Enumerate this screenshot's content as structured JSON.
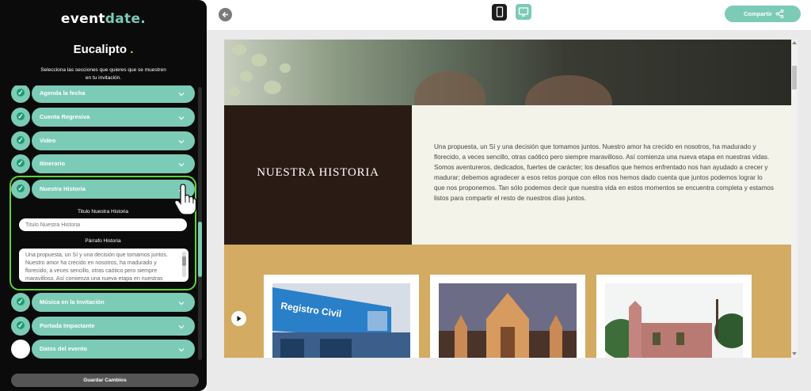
{
  "brand": {
    "logo_main": "event",
    "logo_accent": "date",
    "logo_suffix": "."
  },
  "theme": {
    "name": "Eucalipto",
    "dot": "."
  },
  "instructions": "Selecciona las secciones que quieres que se muestren en tu invitación.",
  "sections": [
    {
      "label": "Agenda la fecha",
      "enabled": true
    },
    {
      "label": "Cuenta Regresiva",
      "enabled": true
    },
    {
      "label": "Video",
      "enabled": true
    },
    {
      "label": "Itinerario",
      "enabled": true
    },
    {
      "label": "Nuestra Historia",
      "enabled": true
    },
    {
      "label": "Música en la Invitación",
      "enabled": true
    },
    {
      "label": "Portada Impactante",
      "enabled": true
    },
    {
      "label": "Datos del evento",
      "enabled": false
    }
  ],
  "editor": {
    "title_label": "Titulo Nuestra Historia",
    "title_placeholder": "Titulo Nuestra Historia",
    "paragraph_label": "Párrafo Historia",
    "paragraph_value": "Una propuesta, un Sí y una decisión que tomamos juntos. Nuestro amor ha crecido en nosotros, ha madurado y florecido, a veces sencillo, otras caótico pero siempre maravilloso. Así comienza una nueva etapa en nuestras vidas."
  },
  "save_button": "Guardar Cambios",
  "share_button": "Compartir",
  "preview": {
    "story_title": "NUESTRA HISTORIA",
    "story_text": "Una propuesta, un Sí y una decisión que tomamos juntos. Nuestro amor ha crecido en nosotros, ha madurado y florecido, a veces sencillo, otras caótico pero siempre maravilloso. Así comienza una nueva etapa en nuestras vidas. Somos aventureros, dedicados, fuertes de carácter; los desafíos que hemos enfrentado nos han ayudado a crecer y madurar; debemos agradecer a esos retos porque con ellos nos hemos dado cuenta que juntos podemos lograr lo que nos proponemos. Tan sólo podemos decir que nuestra vida en estos momentos se encuentra completa y estamos listos para compartir el resto de nuestros días juntos.",
    "sign_text": "Registro Civil"
  },
  "colors": {
    "accent": "#7ccbb7",
    "highlight": "#5fd33b",
    "gallery": "#d3ab63",
    "story_dark": "#2a1c14"
  }
}
